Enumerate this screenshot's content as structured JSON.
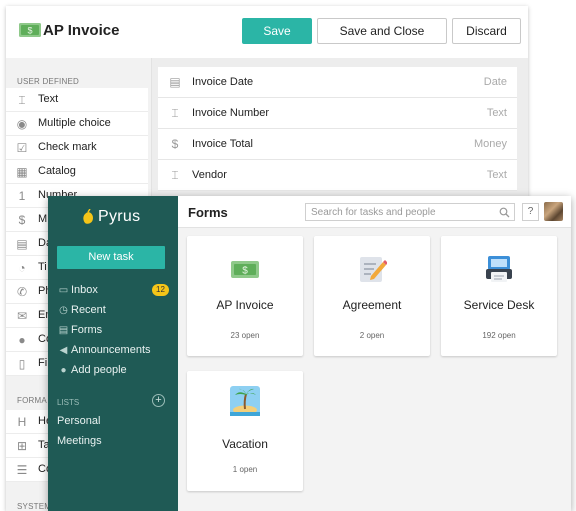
{
  "editor": {
    "title": "AP Invoice",
    "buttons": {
      "save": "Save",
      "save_and_close": "Save and Close",
      "discard": "Discard"
    },
    "palette": {
      "user_defined_head": "USER DEFINED",
      "items": [
        {
          "icon": "text-icon",
          "label": "Text"
        },
        {
          "icon": "radio-icon",
          "label": "Multiple choice"
        },
        {
          "icon": "checkbox-icon",
          "label": "Check mark"
        },
        {
          "icon": "catalog-icon",
          "label": "Catalog"
        },
        {
          "icon": "number-icon",
          "label": "Number"
        },
        {
          "icon": "money-icon",
          "label": "M"
        },
        {
          "icon": "calendar-icon",
          "label": "Da"
        },
        {
          "icon": "timer-icon",
          "label": "Ti"
        },
        {
          "icon": "phone-icon",
          "label": "Ph"
        },
        {
          "icon": "email-icon",
          "label": "Em"
        },
        {
          "icon": "person-icon",
          "label": "Co"
        },
        {
          "icon": "file-icon",
          "label": "Fi"
        }
      ],
      "formatting_head": "FORMA",
      "formatting_items": [
        {
          "icon": "heading-icon",
          "label": "He"
        },
        {
          "icon": "table-icon",
          "label": "Ta"
        },
        {
          "icon": "list-icon",
          "label": "Co"
        }
      ],
      "system_head": "SYSTEM"
    },
    "fields": [
      {
        "icon": "calendar-icon",
        "name": "Invoice Date",
        "type": "Date"
      },
      {
        "icon": "text-icon",
        "name": "Invoice Number",
        "type": "Text"
      },
      {
        "icon": "money-icon",
        "name": "Invoice Total",
        "type": "Money"
      },
      {
        "icon": "text-icon",
        "name": "Vendor",
        "type": "Text"
      }
    ]
  },
  "app": {
    "brand": "Pyrus",
    "new_task": "New task",
    "nav": [
      {
        "icon": "inbox-icon",
        "label": "Inbox",
        "badge": "12"
      },
      {
        "icon": "clock-icon",
        "label": "Recent"
      },
      {
        "icon": "forms-icon",
        "label": "Forms"
      },
      {
        "icon": "megaphone-icon",
        "label": "Announcements"
      },
      {
        "icon": "add-person-icon",
        "label": "Add people"
      }
    ],
    "lists_head": "LISTS",
    "lists_add": "+",
    "lists": [
      "Personal",
      "Meetings"
    ],
    "page_title": "Forms",
    "search_placeholder": "Search for tasks and people",
    "help": "?",
    "forms": [
      {
        "icon": "money-icon",
        "name": "AP Invoice",
        "open": "23 open"
      },
      {
        "icon": "memo-icon",
        "name": "Agreement",
        "open": "2 open"
      },
      {
        "icon": "service-desk-icon",
        "name": "Service Desk",
        "open": "192 open"
      },
      {
        "icon": "island-icon",
        "name": "Vacation",
        "open": "1 open"
      }
    ]
  }
}
